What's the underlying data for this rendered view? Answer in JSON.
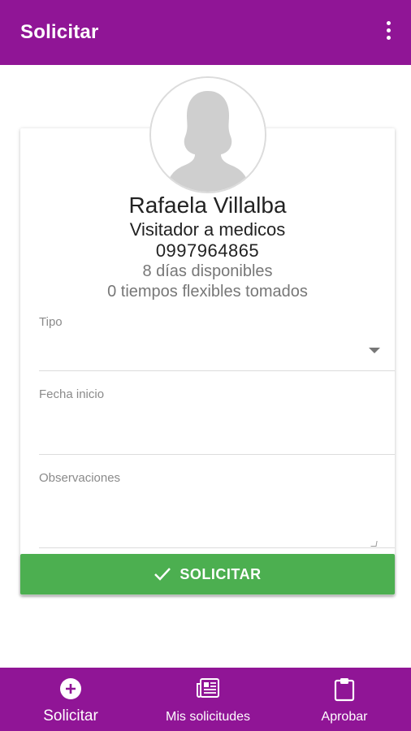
{
  "appbar": {
    "title": "Solicitar",
    "menu_icon": "more-vert-icon"
  },
  "profile": {
    "avatar_icon": "avatar-silhouette-icon",
    "name": "Rafaela Villalba",
    "role": "Visitador a medicos",
    "phone": "0997964865",
    "days": "8 días disponibles",
    "flex": "0 tiempos flexibles tomados"
  },
  "form": {
    "tipo_label": "Tipo",
    "fecha_label": "Fecha inicio",
    "observaciones_label": "Observaciones"
  },
  "submit": {
    "label": "SOLICITAR",
    "icon": "check-icon",
    "color": "#4caf50"
  },
  "bottom_nav": {
    "items": [
      {
        "label": "Solicitar",
        "icon": "add-circle-icon"
      },
      {
        "label": "Mis solicitudes",
        "icon": "newspaper-icon"
      },
      {
        "label": "Aprobar",
        "icon": "clipboard-icon"
      }
    ]
  },
  "colors": {
    "primary": "#901596",
    "accent": "#4caf50"
  }
}
